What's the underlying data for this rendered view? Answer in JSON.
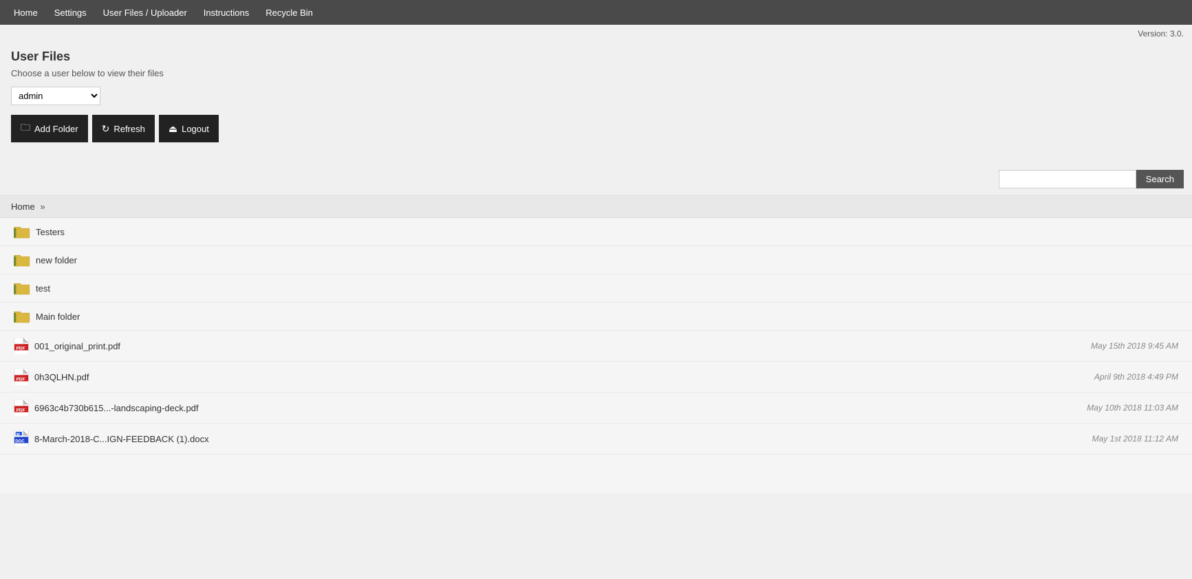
{
  "nav": {
    "items": [
      {
        "label": "Home",
        "id": "home"
      },
      {
        "label": "Settings",
        "id": "settings"
      },
      {
        "label": "User Files / Uploader",
        "id": "user-files"
      },
      {
        "label": "Instructions",
        "id": "instructions"
      },
      {
        "label": "Recycle Bin",
        "id": "recycle-bin"
      }
    ]
  },
  "version": {
    "label": "Version:",
    "value": "3.0."
  },
  "page": {
    "title": "User Files",
    "subtitle": "Choose a user below to view their files"
  },
  "user_dropdown": {
    "selected": "admin",
    "options": [
      "admin"
    ]
  },
  "buttons": {
    "add_folder": "Add Folder",
    "refresh": "Refresh",
    "logout": "Logout"
  },
  "search": {
    "placeholder": "",
    "button_label": "Search"
  },
  "breadcrumb": {
    "home": "Home",
    "separator": "»"
  },
  "folders": [
    {
      "name": "Testers"
    },
    {
      "name": "new folder"
    },
    {
      "name": "test"
    },
    {
      "name": "Main folder"
    }
  ],
  "files": [
    {
      "name": "001_original_print.pdf",
      "type": "pdf",
      "date": "May 15th 2018 9:45 AM"
    },
    {
      "name": "0h3QLHN.pdf",
      "type": "pdf",
      "date": "April 9th 2018 4:49 PM"
    },
    {
      "name": "6963c4b730b615...-landscaping-deck.pdf",
      "type": "pdf",
      "date": "May 10th 2018 11:03 AM"
    },
    {
      "name": "8-March-2018-C...IGN-FEEDBACK (1).docx",
      "type": "docx",
      "date": "May 1st 2018 11:12 AM"
    }
  ]
}
